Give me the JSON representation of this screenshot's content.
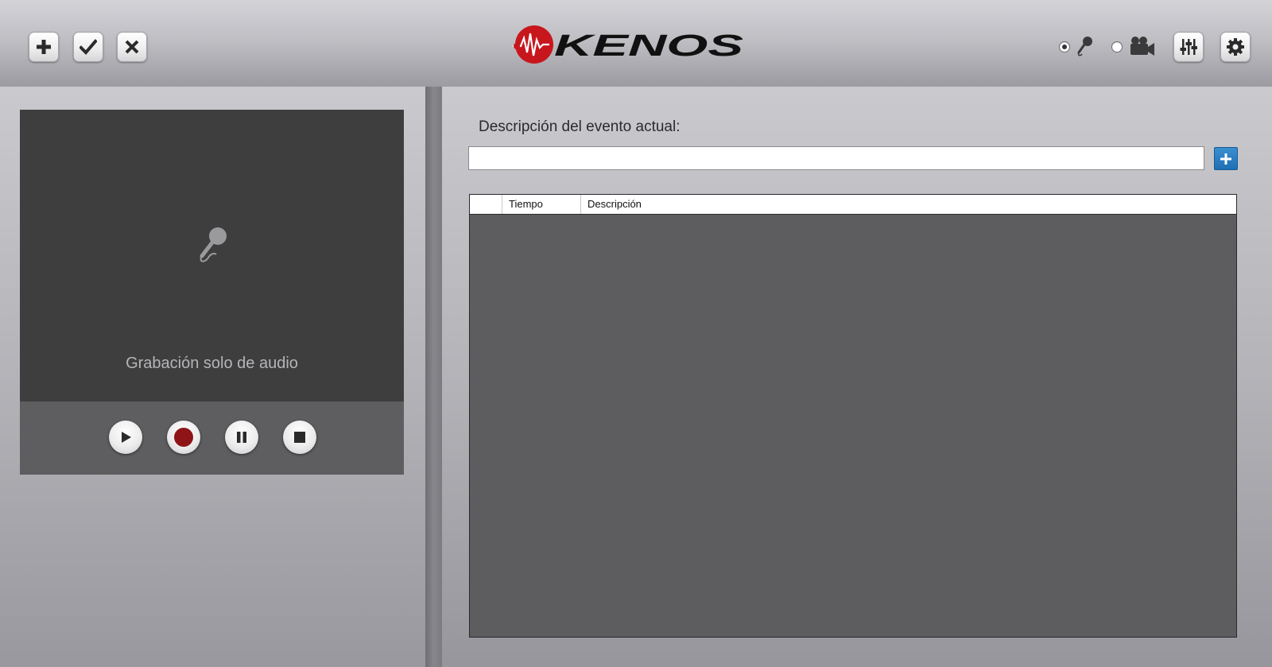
{
  "header": {
    "toolbar": [
      {
        "icon": "plus-icon"
      },
      {
        "icon": "check-icon"
      },
      {
        "icon": "close-icon"
      }
    ],
    "logo_text": "KENOS",
    "logo_color": "#c8161d",
    "mode": {
      "audio": {
        "icon": "microphone-icon",
        "selected": true
      },
      "video": {
        "icon": "video-camera-icon",
        "selected": false
      }
    },
    "right_buttons": [
      {
        "icon": "sliders-icon"
      },
      {
        "icon": "gear-icon"
      }
    ]
  },
  "player": {
    "caption": "Grabación solo de audio",
    "icon": "microphone-icon",
    "controls": [
      {
        "name": "play",
        "icon": "play-icon"
      },
      {
        "name": "record",
        "icon": "record-icon",
        "color": "#8e1418"
      },
      {
        "name": "pause",
        "icon": "pause-icon"
      },
      {
        "name": "stop",
        "icon": "stop-icon"
      }
    ]
  },
  "event": {
    "label": "Descripción del evento actual:",
    "value": "",
    "add_button_color": "#1f6fb3"
  },
  "table": {
    "columns": [
      "",
      "Tiempo",
      "Descripción"
    ],
    "rows": []
  }
}
